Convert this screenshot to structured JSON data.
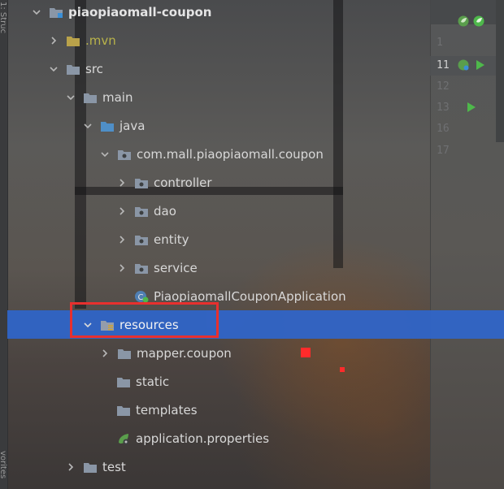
{
  "sidebar": {
    "vertical_top": "1: Struc",
    "vertical_bottom": "vorites"
  },
  "tree": {
    "rows": [
      {
        "label": "piaopiaomall-coupon"
      },
      {
        "label": ".mvn"
      },
      {
        "label": "src"
      },
      {
        "label": "main"
      },
      {
        "label": "java"
      },
      {
        "label": "com.mall.piaopiaomall.coupon"
      },
      {
        "label": "controller"
      },
      {
        "label": "dao"
      },
      {
        "label": "entity"
      },
      {
        "label": "service"
      },
      {
        "label": "PiaopiaomallCouponApplication"
      },
      {
        "label": "resources"
      },
      {
        "label": "mapper.coupon"
      },
      {
        "label": "static"
      },
      {
        "label": "templates"
      },
      {
        "label": "application.properties"
      },
      {
        "label": "test"
      }
    ]
  },
  "editor": {
    "line_numbers": [
      "11",
      "12",
      "13",
      "16",
      "17"
    ],
    "partial_line_top": "1"
  },
  "colors": {
    "selection": "#2f65ca",
    "highlight_box": "#e8302e",
    "folder": "#8a96a6",
    "source_folder": "#4f8fc7",
    "run_green": "#4eb84b"
  }
}
